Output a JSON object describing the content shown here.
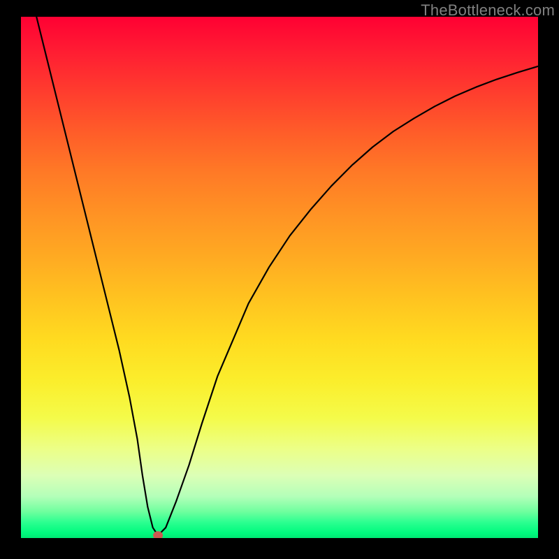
{
  "attribution": "TheBottleneck.com",
  "colors": {
    "frame": "#000000",
    "gradient_top": "#ff0033",
    "gradient_bottom": "#00e874",
    "curve": "#000000",
    "dot": "#cc5a52"
  },
  "chart_data": {
    "type": "line",
    "title": "",
    "xlabel": "",
    "ylabel": "",
    "xlim": [
      0,
      100
    ],
    "ylim": [
      0,
      100
    ],
    "x": [
      3,
      5,
      7,
      9,
      11,
      13,
      15,
      17,
      19,
      21,
      22.5,
      23.5,
      24.5,
      25.5,
      26.5,
      28,
      30,
      32.5,
      35,
      38,
      41,
      44,
      48,
      52,
      56,
      60,
      64,
      68,
      72,
      76,
      80,
      84,
      88,
      92,
      96,
      100
    ],
    "y": [
      100,
      92,
      84,
      76,
      68,
      60,
      52,
      44,
      36,
      27,
      19,
      12,
      6,
      2,
      0.5,
      2,
      7,
      14,
      22,
      31,
      38,
      45,
      52,
      58,
      63,
      67.5,
      71.5,
      75,
      78,
      80.5,
      82.8,
      84.8,
      86.5,
      88,
      89.3,
      90.5
    ],
    "marker": {
      "x": 26.5,
      "y": 0.5
    }
  }
}
